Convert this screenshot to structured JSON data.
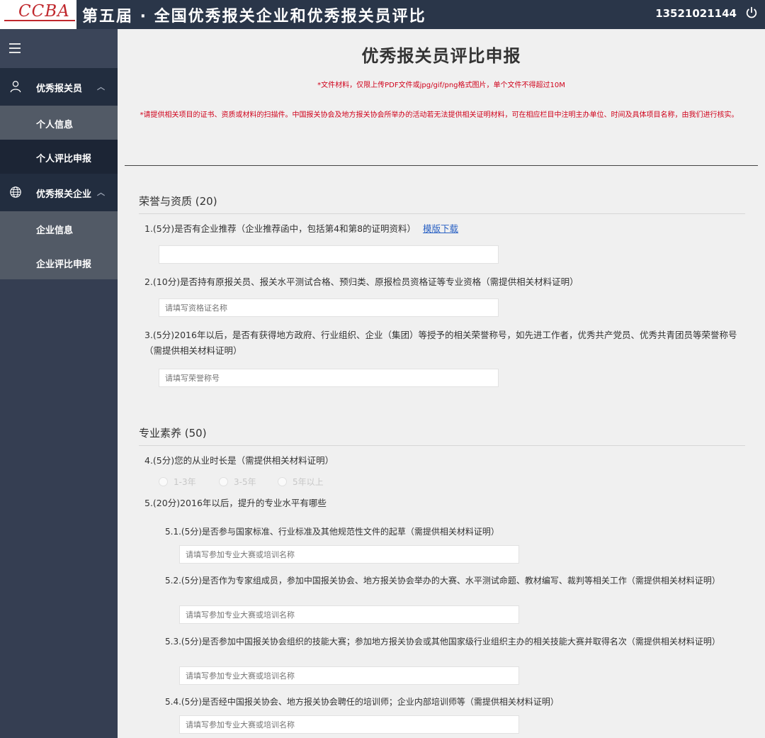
{
  "header": {
    "logo_text": "CCBA",
    "title": "第五届 · 全国优秀报关企业和优秀报关员评比",
    "user": "13521021144",
    "power_icon": "power-icon"
  },
  "sidebar": {
    "menu_icon": "hamburger-icon",
    "groups": [
      {
        "label": "优秀报关员",
        "icon": "user-icon",
        "items": [
          "个人信息",
          "个人评比申报"
        ]
      },
      {
        "label": "优秀报关企业",
        "icon": "globe-icon",
        "items": [
          "企业信息",
          "企业评比申报"
        ]
      }
    ]
  },
  "main": {
    "title": "优秀报关员评比申报",
    "notice1": "*文件材料，仅限上传PDF文件或jpg/gif/png格式图片，单个文件不得超过10M",
    "notice2": "*请提供相关项目的证书、资质或材料的扫描件。中国报关协会及地方报关协会所举办的活动若无法提供相关证明材料，可在相应栏目中注明主办单位、时间及具体项目名称，由我们进行核实。",
    "sections": [
      {
        "title": "荣誉与资质 (20)",
        "questions": [
          {
            "text": "1.(5分)是否有企业推荐（企业推荐函中，包括第4和第8的证明资料）",
            "link": "模版下载",
            "placeholder": ""
          },
          {
            "text": "2.(10分)是否持有原报关员、报关水平测试合格、预归类、原报检员资格证等专业资格（需提供相关材料证明）",
            "placeholder": "请填写资格证名称"
          },
          {
            "text": "3.(5分)2016年以后，是否有获得地方政府、行业组织、企业（集团）等授予的相关荣誉称号，如先进工作者，优秀共产党员、优秀共青团员等荣誉称号（需提供相关材料证明）",
            "placeholder": "请填写荣誉称号"
          }
        ]
      },
      {
        "title": "专业素养 (50)",
        "q4": {
          "text": "4.(5分)您的从业时长是（需提供相关材料证明）",
          "options": [
            "1-3年",
            "3-5年",
            "5年以上"
          ]
        },
        "q5": {
          "text": "5.(20分)2016年以后，提升的专业水平有哪些"
        },
        "subs": [
          {
            "text": "5.1.(5分)是否参与国家标准、行业标准及其他规范性文件的起草（需提供相关材料证明）",
            "placeholder": "请填写参加专业大赛或培训名称"
          },
          {
            "text": "5.2.(5分)是否作为专家组成员，参加中国报关协会、地方报关协会举办的大赛、水平测试命题、教材编写、裁判等相关工作（需提供相关材料证明）",
            "placeholder": "请填写参加专业大赛或培训名称"
          },
          {
            "text": "5.3.(5分)是否参加中国报关协会组织的技能大赛；参加地方报关协会或其他国家级行业组织主办的相关技能大赛并取得名次（需提供相关材料证明）",
            "placeholder": "请填写参加专业大赛或培训名称"
          },
          {
            "text": "5.4.(5分)是否经中国报关协会、地方报关协会聘任的培训师；企业内部培训师等（需提供相关材料证明）",
            "placeholder": "请填写参加专业大赛或培训名称"
          }
        ]
      }
    ]
  }
}
